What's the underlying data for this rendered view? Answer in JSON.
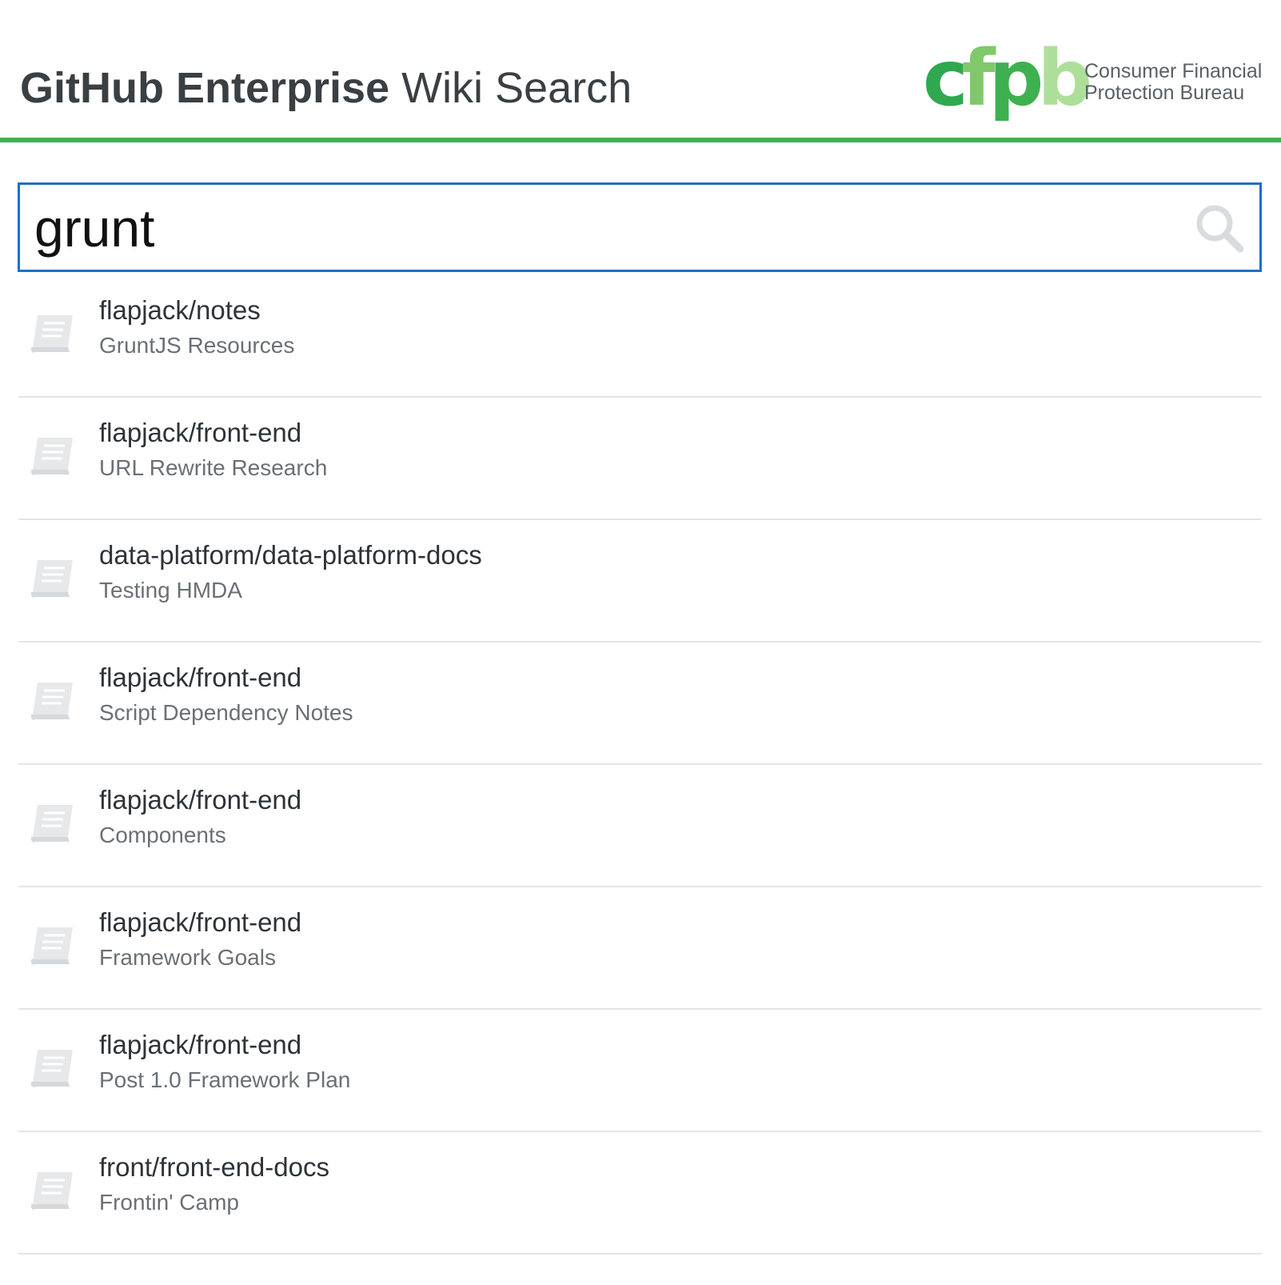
{
  "header": {
    "title_strong": "GitHub Enterprise",
    "title_light": " Wiki Search",
    "logo": {
      "letters": [
        "c",
        "f",
        "p",
        "b"
      ],
      "line1": "Consumer Financial",
      "line2": "Protection Bureau"
    },
    "accent_color": "#3fb04f"
  },
  "search": {
    "value": "grunt",
    "icon": "search-icon",
    "border_color": "#1f6fc5"
  },
  "results": [
    {
      "repo": "flapjack/notes",
      "page": "GruntJS Resources",
      "icon": "book-icon"
    },
    {
      "repo": "flapjack/front-end",
      "page": "URL Rewrite Research",
      "icon": "book-icon"
    },
    {
      "repo": "data-platform/data-platform-docs",
      "page": "Testing HMDA",
      "icon": "book-icon"
    },
    {
      "repo": "flapjack/front-end",
      "page": "Script Dependency Notes",
      "icon": "book-icon"
    },
    {
      "repo": "flapjack/front-end",
      "page": "Components",
      "icon": "book-icon"
    },
    {
      "repo": "flapjack/front-end",
      "page": "Framework Goals",
      "icon": "book-icon"
    },
    {
      "repo": "flapjack/front-end",
      "page": "Post 1.0 Framework Plan",
      "icon": "book-icon"
    },
    {
      "repo": "front/front-end-docs",
      "page": "Frontin' Camp",
      "icon": "book-icon"
    }
  ]
}
